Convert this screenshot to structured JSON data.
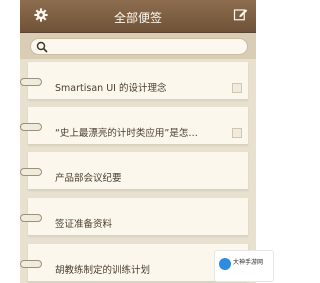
{
  "header": {
    "title": "全部便签",
    "settings_icon": "gear-icon",
    "compose_icon": "compose-icon"
  },
  "search": {
    "placeholder": "",
    "icon": "search-icon"
  },
  "notes": [
    {
      "date": "",
      "text": "Smartisan UI 的设计理念"
    },
    {
      "date": "",
      "text": "“史上最漂亮的计时类应用”是怎…"
    },
    {
      "date": "",
      "text": "产品部会议纪要"
    },
    {
      "date": "",
      "text": "签证准备资料"
    },
    {
      "date": "",
      "text": "胡教练制定的训练计划"
    }
  ],
  "watermark": {
    "text": "大神手游网",
    "sub": ""
  },
  "colors": {
    "topbar": "#7a5c42",
    "paper": "#fbf7ec",
    "background": "#e9e1cf"
  }
}
